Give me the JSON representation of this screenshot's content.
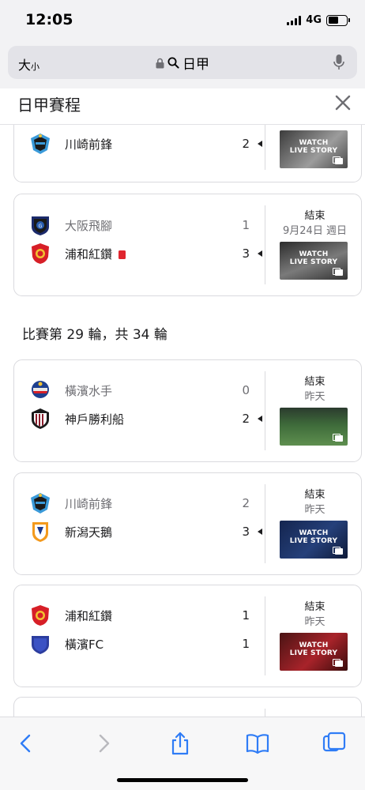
{
  "status_bar": {
    "time": "12:05",
    "network": "4G"
  },
  "url_bar": {
    "text_size_big": "大",
    "text_size_small": "小",
    "query": "日甲"
  },
  "header": {
    "title": "日甲賽程"
  },
  "colors": {
    "accent": "#2f7cf6",
    "text": "#1c1c1e",
    "secondary": "#6e6e73",
    "red_card": "#e0262f"
  },
  "matches": [
    {
      "home": {
        "name": "川崎前鋒",
        "score": "2",
        "logo": "kawasaki-frontale-logo"
      },
      "thumb_text": [
        "WATCH",
        "LIVE STORY"
      ]
    },
    {
      "home": {
        "name": "大阪飛腳",
        "score": "1",
        "logo": "gamba-osaka-logo"
      },
      "away": {
        "name": "浦和紅鑽",
        "score": "3",
        "logo": "urawa-reds-logo"
      },
      "status": "結束",
      "date": "9月24日 週日",
      "thumb_text": [
        "WATCH",
        "LIVE STORY"
      ]
    }
  ],
  "round": {
    "label": "比賽第 29 輪，共 34 輪"
  },
  "round_matches": [
    {
      "home": {
        "name": "橫濱水手",
        "score": "0",
        "logo": "yokohama-marinos-logo"
      },
      "away": {
        "name": "神戶勝利船",
        "score": "2",
        "logo": "vissel-kobe-logo"
      },
      "status": "結束",
      "date": "昨天"
    },
    {
      "home": {
        "name": "川崎前鋒",
        "score": "2",
        "logo": "kawasaki-frontale-logo"
      },
      "away": {
        "name": "新潟天鵝",
        "score": "3",
        "logo": "albirex-niigata-logo"
      },
      "status": "結束",
      "date": "昨天",
      "thumb_text": [
        "WATCH",
        "LIVE STORY"
      ]
    },
    {
      "home": {
        "name": "浦和紅鑽",
        "score": "1",
        "logo": "urawa-reds-logo"
      },
      "away": {
        "name": "橫濱FC",
        "score": "1",
        "logo": "yokohama-fc-logo"
      },
      "status": "結束",
      "date": "昨天",
      "thumb_text": [
        "WATCH",
        "LIVE STORY"
      ]
    }
  ],
  "toolbar": {
    "back": "back-chevron-icon",
    "forward": "forward-chevron-icon",
    "share": "share-icon",
    "bookmarks": "bookmarks-icon",
    "tabs": "tabs-icon"
  }
}
